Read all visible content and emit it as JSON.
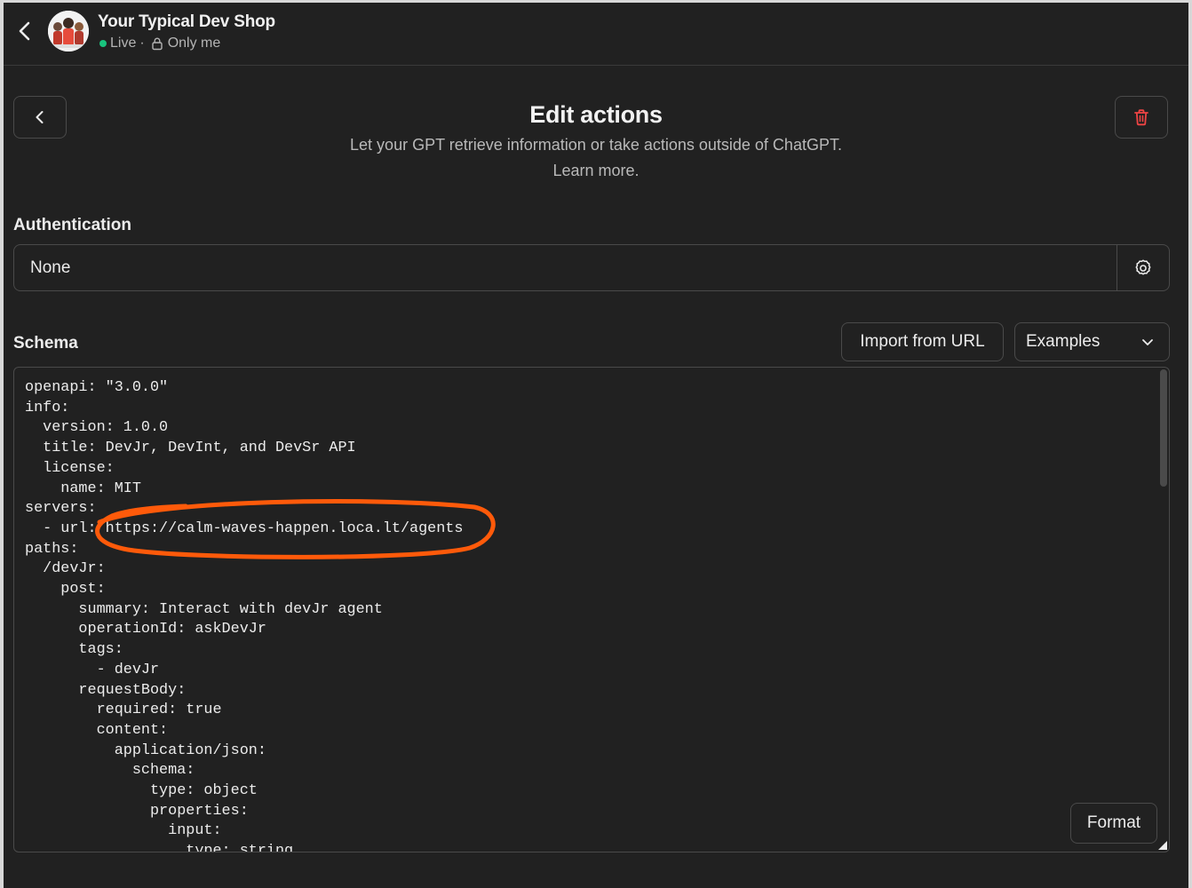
{
  "header": {
    "gpt_name": "Your Typical Dev Shop",
    "status_live": "Live",
    "status_separator": "·",
    "visibility": "Only me",
    "live_color": "#19c37d"
  },
  "edit": {
    "title": "Edit actions",
    "subtitle": "Let your GPT retrieve information or take actions outside of ChatGPT.",
    "learn_more": "Learn more.",
    "delete_color": "#ef4444"
  },
  "authentication": {
    "label": "Authentication",
    "value": "None",
    "settings_icon": "gear-icon"
  },
  "schema": {
    "label": "Schema",
    "import_label": "Import from URL",
    "examples_label": "Examples",
    "format_label": "Format",
    "code_lines": [
      "openapi: \"3.0.0\"",
      "info:",
      "  version: 1.0.0",
      "  title: DevJr, DevInt, and DevSr API",
      "  license:",
      "    name: MIT",
      "servers:",
      "  - url: https://calm-waves-happen.loca.lt/agents",
      "paths:",
      "  /devJr:",
      "    post:",
      "      summary: Interact with devJr agent",
      "      operationId: askDevJr",
      "      tags:",
      "        - devJr",
      "      requestBody:",
      "        required: true",
      "        content:",
      "          application/json:",
      "            schema:",
      "              type: object",
      "              properties:",
      "                input:",
      "                  type: string"
    ]
  },
  "annotation": {
    "color": "#ff5a0a"
  }
}
